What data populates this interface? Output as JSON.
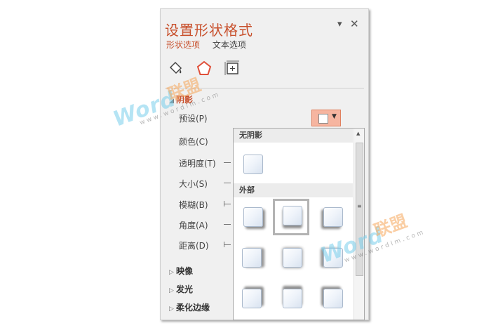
{
  "pane": {
    "title": "设置形状格式",
    "tabs": [
      {
        "label": "形状选项",
        "active": true
      },
      {
        "label": "文本选项",
        "active": false
      }
    ],
    "icons": [
      "fill-line-icon",
      "effects-pentagon-icon",
      "size-properties-icon"
    ]
  },
  "shadow": {
    "header": "阴影",
    "properties": [
      {
        "label": "预设(P)"
      },
      {
        "label": "颜色(C)"
      },
      {
        "label": "透明度(T)"
      },
      {
        "label": "大小(S)"
      },
      {
        "label": "模糊(B)"
      },
      {
        "label": "角度(A)"
      },
      {
        "label": "距离(D)"
      }
    ]
  },
  "sections": [
    {
      "label": "映像"
    },
    {
      "label": "发光"
    },
    {
      "label": "柔化边缘"
    }
  ],
  "dropdown": {
    "categories": [
      {
        "label": "无阴影"
      },
      {
        "label": "外部"
      }
    ]
  },
  "watermark": {
    "brand_latin": "Word",
    "brand_cn": "联盟",
    "url": "www.wordlm.com"
  },
  "colors": {
    "accent": "#c8502c",
    "preset_button": "#f6b5a0",
    "selection_frame": "#b3b3b3"
  }
}
